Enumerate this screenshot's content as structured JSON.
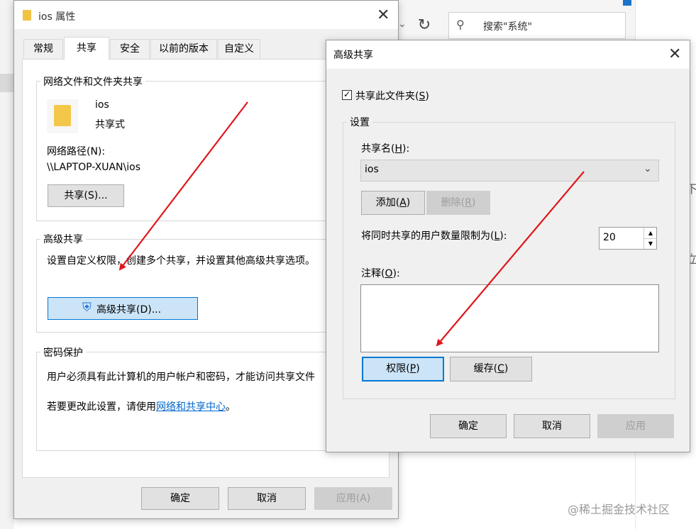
{
  "explorer": {
    "search_placeholder": "搜索\"系统\"",
    "right_fragment_1": "下",
    "right_fragment_2": "立"
  },
  "props": {
    "title": "ios 属性",
    "tabs": [
      "常规",
      "共享",
      "安全",
      "以前的版本",
      "自定义"
    ],
    "active_tab": "共享",
    "network_group": "网络文件和文件夹共享",
    "folder_name": "ios",
    "folder_status": "共享式",
    "path_label": "网络路径(N):",
    "path_value": "\\\\LAPTOP-XUAN\\ios",
    "share_button": "共享(S)...",
    "advanced_group": "高级共享",
    "advanced_desc": "设置自定义权限，创建多个共享，并设置其他高级共享选项。",
    "advanced_button": "高级共享(D)...",
    "password_group": "密码保护",
    "password_desc": "用户必须具有此计算机的用户帐户和密码，才能访问共享文件",
    "password_change_prefix": "若要更改此设置，请使用",
    "password_change_link": "网络和共享中心",
    "password_change_suffix": "。",
    "ok": "确定",
    "cancel": "取消",
    "apply": "应用(A)"
  },
  "adv": {
    "title": "高级共享",
    "share_checkbox_label": "共享此文件夹(S)",
    "share_checked": true,
    "settings_group": "设置",
    "share_name_label": "共享名(H):",
    "share_name_value": "ios",
    "add_button": "添加(A)",
    "remove_button": "删除(R)",
    "limit_label": "将同时共享的用户数量限制为(L):",
    "limit_value": "20",
    "comment_label": "注释(O):",
    "permissions_button": "权限(P)",
    "cache_button": "缓存(C)",
    "ok": "确定",
    "cancel": "取消",
    "apply": "应用"
  },
  "watermark": "@稀土掘金技术社区",
  "colors": {
    "arrow": "#e0161b",
    "link": "#0066cc",
    "focus": "#0078d7"
  }
}
